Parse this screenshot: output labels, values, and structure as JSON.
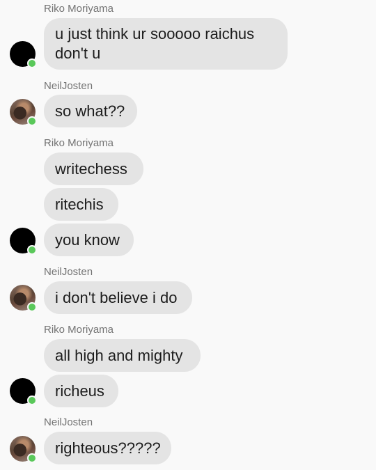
{
  "colors": {
    "background": "#f9f9f9",
    "bubble": "#e4e4e4",
    "online": "#5ac85a",
    "sender_name": "#737373"
  },
  "messages": [
    {
      "sender": "Riko Moriyama",
      "texts": [
        "u just think ur sooooo raichus don't u"
      ]
    },
    {
      "sender": "NeilJosten",
      "texts": [
        "so what??"
      ]
    },
    {
      "sender": "Riko Moriyama",
      "texts": [
        "writechess",
        "ritechis",
        "you know"
      ]
    },
    {
      "sender": "NeilJosten",
      "texts": [
        "i don't believe i do"
      ]
    },
    {
      "sender": "Riko Moriyama",
      "texts": [
        "all high and mighty",
        "richeus"
      ]
    },
    {
      "sender": "NeilJosten",
      "texts": [
        "righteous?????"
      ]
    }
  ]
}
